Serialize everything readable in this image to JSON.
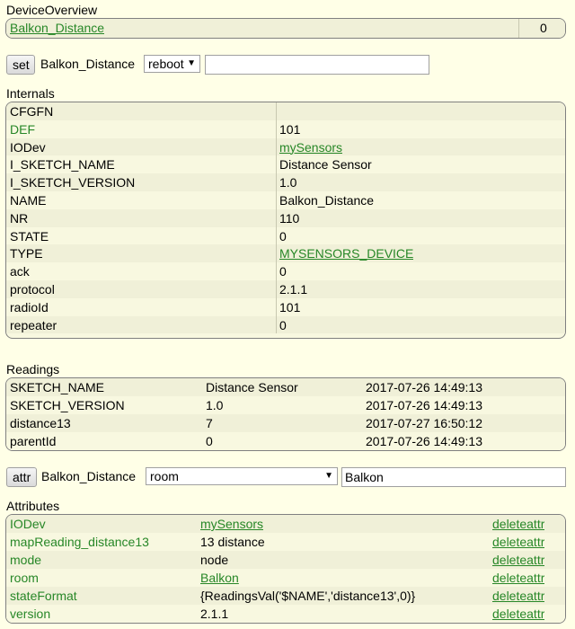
{
  "device_overview": {
    "title": "DeviceOverview",
    "device_name": "Balkon_Distance",
    "value": "0"
  },
  "set_bar": {
    "button": "set",
    "device": "Balkon_Distance",
    "selected": "reboot",
    "input_value": ""
  },
  "internals": {
    "title": "Internals",
    "rows": [
      {
        "key": "CFGFN",
        "value": "",
        "key_green": false,
        "value_link": false
      },
      {
        "key": "DEF",
        "value": "101",
        "key_green": true,
        "value_link": false
      },
      {
        "key": "IODev",
        "value": "mySensors",
        "key_green": false,
        "value_link": true
      },
      {
        "key": "I_SKETCH_NAME",
        "value": "Distance Sensor",
        "key_green": false,
        "value_link": false
      },
      {
        "key": "I_SKETCH_VERSION",
        "value": "1.0",
        "key_green": false,
        "value_link": false
      },
      {
        "key": "NAME",
        "value": "Balkon_Distance",
        "key_green": false,
        "value_link": false
      },
      {
        "key": "NR",
        "value": "110",
        "key_green": false,
        "value_link": false
      },
      {
        "key": "STATE",
        "value": "0",
        "key_green": false,
        "value_link": false
      },
      {
        "key": "TYPE",
        "value": "MYSENSORS_DEVICE",
        "key_green": false,
        "value_link": true
      },
      {
        "key": "ack",
        "value": "0",
        "key_green": false,
        "value_link": false
      },
      {
        "key": "protocol",
        "value": "2.1.1",
        "key_green": false,
        "value_link": false
      },
      {
        "key": "radioId",
        "value": "101",
        "key_green": false,
        "value_link": false
      },
      {
        "key": "repeater",
        "value": "0",
        "key_green": false,
        "value_link": false
      }
    ]
  },
  "readings": {
    "title": "Readings",
    "rows": [
      {
        "name": "SKETCH_NAME",
        "value": "Distance Sensor",
        "time": "2017-07-26 14:49:13"
      },
      {
        "name": "SKETCH_VERSION",
        "value": "1.0",
        "time": "2017-07-26 14:49:13"
      },
      {
        "name": "distance13",
        "value": "7",
        "time": "2017-07-27 16:50:12"
      },
      {
        "name": "parentId",
        "value": "0",
        "time": "2017-07-26 14:49:13"
      }
    ]
  },
  "attr_bar": {
    "button": "attr",
    "device": "Balkon_Distance",
    "selected": "room",
    "input_value": "Balkon"
  },
  "attributes": {
    "title": "Attributes",
    "delete_label": "deleteattr",
    "rows": [
      {
        "name": "IODev",
        "value": "mySensors",
        "value_link": true
      },
      {
        "name": "mapReading_distance13",
        "value": "13 distance",
        "value_link": false
      },
      {
        "name": "mode",
        "value": "node",
        "value_link": false
      },
      {
        "name": "room",
        "value": "Balkon",
        "value_link": true
      },
      {
        "name": "stateFormat",
        "value": "{ReadingsVal('$NAME','distance13',0)}",
        "value_link": false
      },
      {
        "name": "version",
        "value": "2.1.1",
        "value_link": false
      }
    ]
  },
  "colors": {
    "background": "#FFFFE7",
    "link_green": "#278727",
    "row_even": "#F0F0D8",
    "row_odd": "#F8F8E0"
  }
}
